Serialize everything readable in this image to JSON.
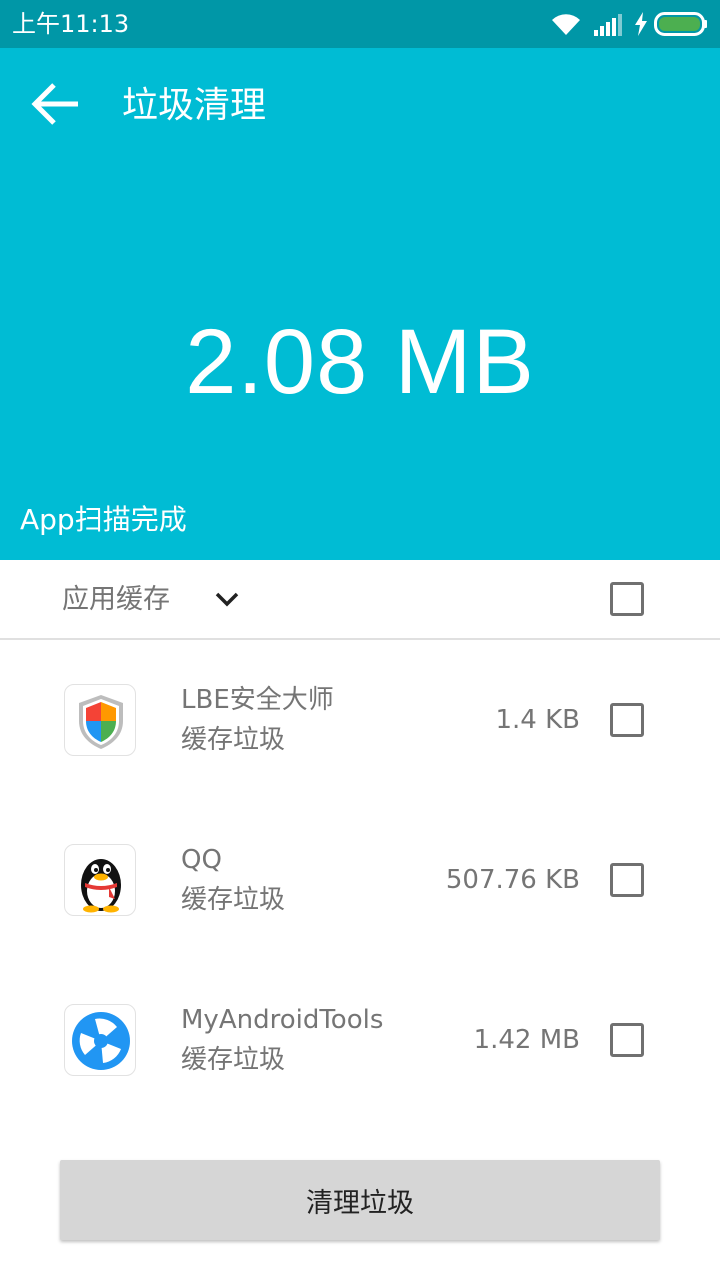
{
  "status_bar": {
    "time": "上午11:13",
    "icons": [
      "wifi-icon",
      "signal-icon",
      "charging-icon",
      "battery-icon"
    ],
    "battery_color": "#4caf50"
  },
  "header": {
    "title": "垃圾清理",
    "back_icon": "arrow-left-icon",
    "total_size": "2.08 MB",
    "scan_status": "App扫描完成"
  },
  "colors": {
    "status_bar": "#0097a7",
    "header": "#00bcd4",
    "button": "#d6d6d6"
  },
  "category": {
    "label": "应用缓存",
    "icon": "chevron-down-icon",
    "checked": false
  },
  "apps": [
    {
      "name": "LBE安全大师",
      "type": "缓存垃圾",
      "size": "1.4 KB",
      "icon": "lbe-shield-icon",
      "checked": false
    },
    {
      "name": "QQ",
      "type": "缓存垃圾",
      "size": "507.76 KB",
      "icon": "qq-penguin-icon",
      "checked": false
    },
    {
      "name": "MyAndroidTools",
      "type": "缓存垃圾",
      "size": "1.42 MB",
      "icon": "myandroidtools-icon",
      "checked": false
    }
  ],
  "actions": {
    "clean_label": "清理垃圾"
  }
}
